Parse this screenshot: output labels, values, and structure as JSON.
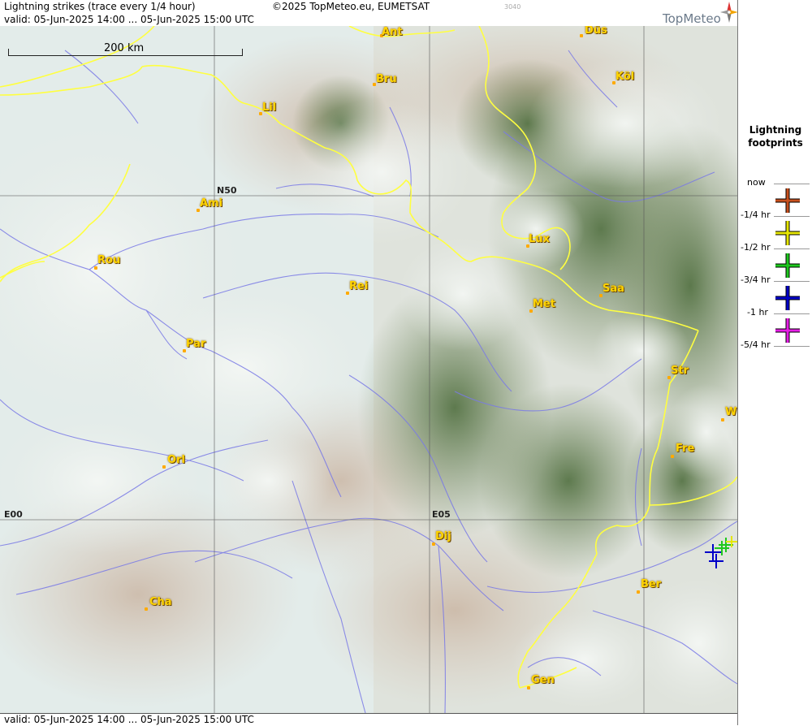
{
  "header": {
    "title": "Lightning strikes (trace every 1/4 hour)",
    "copyright": "©2025 TopMeteo.eu, EUMETSAT",
    "code": "3040",
    "valid": "valid:  05-Jun-2025 14:00 ... 05-Jun-2025 15:00 UTC",
    "logo": "TopMeteo"
  },
  "footer": {
    "valid": "valid:  05-Jun-2025 14:00 ... 05-Jun-2025 15:00 UTC"
  },
  "scale": {
    "label": "200 km"
  },
  "grid": {
    "n50": "N50",
    "e00": "E00",
    "e05": "E05"
  },
  "cities": [
    "Ant",
    "Düs",
    "Bru",
    "Köl",
    "Lil",
    "Ami",
    "Rou",
    "Rei",
    "Lux",
    "Saa",
    "Met",
    "Par",
    "Str",
    "Fre",
    "Orl",
    "Dij",
    "Cha",
    "Ber",
    "Gen",
    "W"
  ],
  "legend": {
    "title_line1": "Lightning",
    "title_line2": "footprints",
    "entries": [
      {
        "label": "now",
        "color": ""
      },
      {
        "label": "-1/4 hr",
        "color": "#c8501e"
      },
      {
        "label": "-1/2 hr",
        "color": "#e6e600"
      },
      {
        "label": "-3/4 hr",
        "color": "#1ec81e"
      },
      {
        "label": "-1 hr",
        "color": "#0000c8"
      },
      {
        "label": "-5/4 hr",
        "color": "#e61ee6"
      }
    ]
  },
  "colors": {
    "border": "#ffff40",
    "rivers": "#7a7ae6",
    "grid": "#555555"
  }
}
